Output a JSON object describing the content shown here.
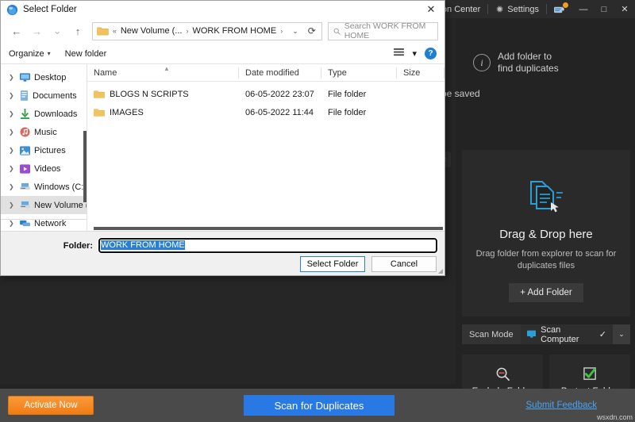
{
  "app": {
    "titlebar": {
      "action_center": "Action Center",
      "settings": "Settings",
      "minimize": "—",
      "maximize": "□",
      "close": "✕"
    },
    "hint": {
      "line1": "Add folder to",
      "line2": "find duplicates",
      "icon": "info-icon"
    },
    "saved_text": "be saved",
    "dropzone": {
      "title": "Drag & Drop here",
      "subtitle": "Drag folder from explorer to scan for duplicates files",
      "add_folder": "+ Add Folder",
      "icon": "documents-icon"
    },
    "scan_mode": {
      "label": "Scan Mode",
      "selected": "Scan Computer",
      "check": "✓",
      "caret": "⌄"
    },
    "tiles": [
      {
        "label": "Exclude Folder",
        "icon": "exclude-search-icon"
      },
      {
        "label": "Protect Folder",
        "icon": "protect-check-icon"
      }
    ],
    "bottombar": {
      "activate": "Activate Now",
      "scan": "Scan for Duplicates",
      "feedback": "Submit Feedback"
    },
    "watermark": "wsxdn.com",
    "colors": {
      "accent_blue": "#2879e3",
      "activate_orange": "#f07c14",
      "link_blue": "#4aa3f0",
      "protect_green": "#3fc23f",
      "exclude_red": "#d94a4a"
    }
  },
  "dialog": {
    "title": "Select Folder",
    "close": "✕",
    "nav": {
      "back": "←",
      "forward": "→",
      "recent": "⌄",
      "up": "↑"
    },
    "address": {
      "folder_icon": "folder-icon",
      "overflow": "«",
      "crumbs": [
        "New Volume (...",
        "WORK FROM HOME"
      ],
      "separator": "›",
      "caret": "⌄",
      "refresh": "⟳"
    },
    "search": {
      "placeholder": "Search WORK FROM HOME",
      "icon": "search-icon"
    },
    "commandbar": {
      "organize": "Organize",
      "organize_caret": "▾",
      "new_folder": "New folder",
      "view_icon": "view-list-icon",
      "view_caret": "▾",
      "help": "?"
    },
    "tree": [
      {
        "label": "Desktop",
        "icon": "desktop-icon",
        "selected": false
      },
      {
        "label": "Documents",
        "icon": "documents-icon",
        "selected": false
      },
      {
        "label": "Downloads",
        "icon": "downloads-icon",
        "selected": false
      },
      {
        "label": "Music",
        "icon": "music-icon",
        "selected": false
      },
      {
        "label": "Pictures",
        "icon": "pictures-icon",
        "selected": false
      },
      {
        "label": "Videos",
        "icon": "videos-icon",
        "selected": false
      },
      {
        "label": "Windows (C:)",
        "icon": "drive-icon",
        "selected": false
      },
      {
        "label": "New Volume (D",
        "icon": "drive-icon",
        "selected": true
      },
      {
        "label": "Network",
        "icon": "network-icon",
        "selected": false
      }
    ],
    "columns": [
      "Name",
      "Date modified",
      "Type",
      "Size"
    ],
    "rows": [
      {
        "name": "BLOGS N SCRIPTS",
        "date": "06-05-2022 23:07",
        "type": "File folder",
        "size": ""
      },
      {
        "name": "IMAGES",
        "date": "06-05-2022 11:44",
        "type": "File folder",
        "size": ""
      }
    ],
    "footer": {
      "folder_label": "Folder:",
      "folder_value": "WORK FROM HOME",
      "select_button": "Select Folder",
      "cancel_button": "Cancel"
    }
  }
}
